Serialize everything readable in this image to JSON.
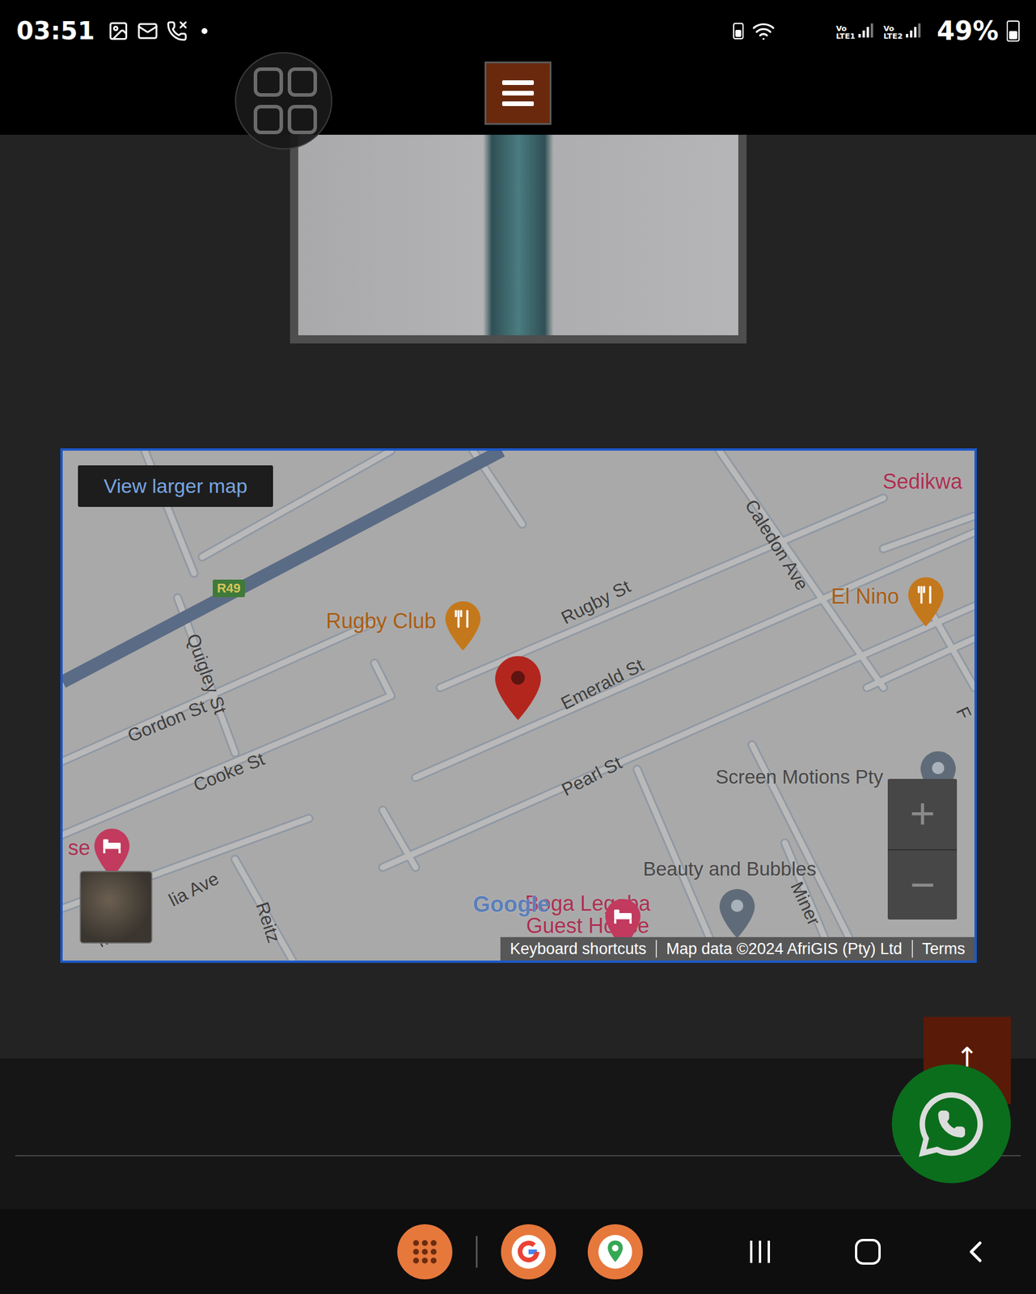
{
  "status_bar": {
    "time": "03:51",
    "sim1": "Vo LTE1",
    "sim2": "Vo LTE2",
    "battery": "49%",
    "battery_level": 0.49
  },
  "map": {
    "button": "View larger map",
    "road_shield": "R49",
    "labels": [
      {
        "text": "Sedikwa",
        "kind": "lodging"
      },
      {
        "text": "Rugby Club",
        "kind": "food"
      },
      {
        "text": "Rugby St",
        "kind": "street"
      },
      {
        "text": "Emerald St",
        "kind": "street"
      },
      {
        "text": "Gordon St",
        "kind": "street"
      },
      {
        "text": "Quigley St",
        "kind": "street"
      },
      {
        "text": "Cooke St",
        "kind": "street"
      },
      {
        "text": "Pearl St",
        "kind": "street"
      },
      {
        "text": "Caledon Ave",
        "kind": "street"
      },
      {
        "text": "El Nino",
        "kind": "food"
      },
      {
        "text": "Screen Motions Pty",
        "kind": "place"
      },
      {
        "text": "Beauty and Bubbles",
        "kind": "place"
      },
      {
        "text": "Boga Legaba",
        "kind": "lodging"
      },
      {
        "text": "Guest House",
        "kind": "lodging"
      },
      {
        "text": "lia Ave",
        "kind": "street"
      },
      {
        "text": "Mag",
        "kind": "street"
      },
      {
        "text": "Reitz",
        "kind": "street"
      },
      {
        "text": "Miner",
        "kind": "street"
      },
      {
        "text": "se",
        "kind": "lodging"
      },
      {
        "text": "F",
        "kind": "street"
      }
    ],
    "pins": [
      {
        "kind": "marker"
      },
      {
        "kind": "food"
      },
      {
        "kind": "food"
      },
      {
        "kind": "lodging"
      },
      {
        "kind": "lodging"
      },
      {
        "kind": "place"
      },
      {
        "kind": "place"
      }
    ],
    "zoom_in": "+",
    "zoom_out": "−",
    "logo": "Google",
    "attribution": [
      "Keyboard shortcuts",
      "Map data ©2024 AfriGIS (Pty) Ltd",
      "Terms"
    ]
  },
  "scroll_top": "↑"
}
